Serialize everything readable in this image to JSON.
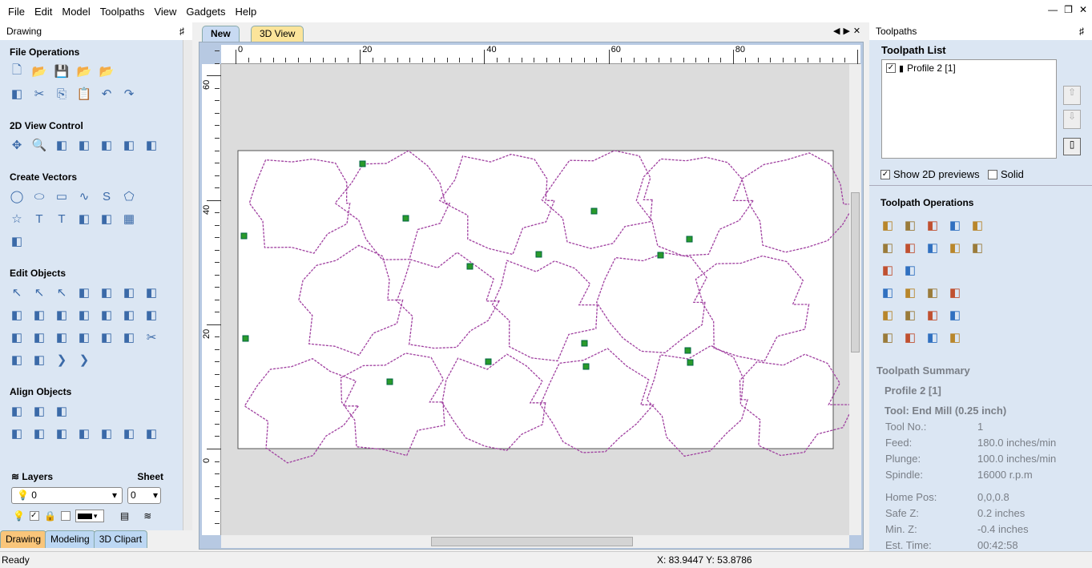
{
  "menu": [
    "File",
    "Edit",
    "Model",
    "Toolpaths",
    "View",
    "Gadgets",
    "Help"
  ],
  "window_controls": [
    "minimize",
    "restore",
    "close"
  ],
  "left_panel": {
    "title": "Drawing",
    "sections": [
      {
        "title": "File Operations",
        "rows": [
          [
            "new-file",
            "open-file",
            "save-file",
            "open-folder",
            "import"
          ],
          [
            "select-all",
            "cut",
            "copy",
            "paste",
            "undo",
            "redo"
          ]
        ]
      },
      {
        "title": "2D View Control",
        "rows": [
          [
            "pan",
            "zoom-box",
            "zoom-all",
            "zoom-selection",
            "view-toggle",
            "view-fit",
            "view-export"
          ]
        ]
      },
      {
        "title": "Create Vectors",
        "rows": [
          [
            "circle",
            "ellipse",
            "rectangle",
            "polyline",
            "curve",
            "polygon"
          ],
          [
            "star",
            "text",
            "text-box",
            "text-on-curve",
            "text-arc",
            "array"
          ],
          [
            "draw-tool"
          ]
        ]
      },
      {
        "title": "Edit Objects",
        "rows": [
          [
            "select",
            "node-edit",
            "transform",
            "group",
            "ungroup",
            "measure",
            "scale"
          ],
          [
            "offset",
            "resize",
            "mirror",
            "align-grid",
            "array-copy",
            "weld",
            "trim"
          ],
          [
            "join",
            "fillet",
            "chamfer",
            "extend",
            "smooth",
            "spline",
            "scissors"
          ],
          [
            "box",
            "bracket",
            "arrow",
            "double-arrow"
          ]
        ]
      },
      {
        "title": "Align Objects",
        "rows": [
          [
            "align-center",
            "align-h",
            "align-v"
          ],
          [
            "align-all",
            "align-left",
            "align-right",
            "align-top",
            "align-bottom",
            "center-h",
            "center-v"
          ]
        ]
      }
    ],
    "layers_label": "Layers",
    "sheet_label": "Sheet",
    "layer_value": "0",
    "sheet_value": "0",
    "tabs": [
      "Drawing",
      "Modeling",
      "3D Clipart"
    ]
  },
  "view": {
    "tabs": [
      "New",
      "3D View"
    ],
    "ruler_x": [
      "0",
      "20",
      "40",
      "60",
      "80"
    ],
    "ruler_y": [
      "60",
      "40",
      "20",
      "0"
    ]
  },
  "right_panel": {
    "title": "Toolpaths",
    "list_title": "Toolpath List",
    "items": [
      {
        "label": "Profile 2 [1]",
        "checked": true
      }
    ],
    "show_2d_previews": {
      "label": "Show 2D previews",
      "checked": true
    },
    "solid": {
      "label": "Solid",
      "checked": false
    },
    "ops_title": "Toolpath Operations",
    "ops_rows": [
      [
        "pocket",
        "profile",
        "drill",
        "vcarve",
        "texture"
      ],
      [
        "inlay",
        "fluting",
        "quick-engrave",
        "prism",
        "chamfer"
      ],
      [
        "moulding",
        "3d-finish"
      ],
      [
        "recalc",
        "edit",
        "delete",
        "summary"
      ],
      [
        "merge",
        "save-toolpath",
        "template",
        "toolpath-array"
      ],
      [
        "material",
        "timer",
        "save",
        "export"
      ]
    ],
    "summary_title": "Toolpath Summary",
    "summary_name": "Profile 2 [1]",
    "summary_tool": "Tool: End Mill (0.25 inch)",
    "summary": [
      {
        "k": "Tool No.:",
        "v": "1"
      },
      {
        "k": "Feed:",
        "v": "180.0 inches/min"
      },
      {
        "k": "Plunge:",
        "v": "100.0 inches/min"
      },
      {
        "k": "Spindle:",
        "v": "16000 r.p.m"
      },
      {
        "k": "Home Pos:",
        "v": "0,0,0.8"
      },
      {
        "k": "Safe Z:",
        "v": "0.2 inches"
      },
      {
        "k": "Min. Z:",
        "v": "-0.4 inches"
      },
      {
        "k": "Est. Time:",
        "v": "00:42:58"
      }
    ]
  },
  "status": {
    "text": "Ready",
    "coords": "X: 83.9447 Y: 53.8786"
  },
  "colors": {
    "toolpath": "#a040a0",
    "node": "#2a9a2a",
    "panel": "#dbe6f3",
    "active_tab": "#f9c57a"
  }
}
